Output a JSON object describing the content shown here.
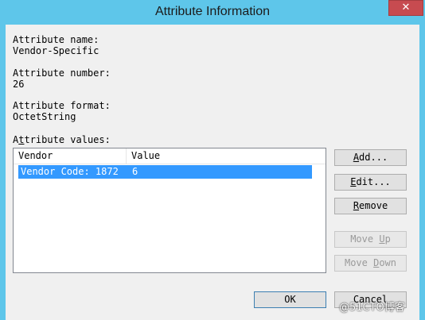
{
  "window": {
    "title": "Attribute Information",
    "close_glyph": "✕"
  },
  "labels": {
    "name_caption": "Attribute name:",
    "name_value": "Vendor-Specific",
    "number_caption": "Attribute number:",
    "number_value": "26",
    "format_caption": "Attribute format:",
    "format_value": "OctetString",
    "values_caption_pre": "A",
    "values_caption_mnemonic": "t",
    "values_caption_post": "tribute values:"
  },
  "table": {
    "columns": [
      "Vendor",
      "Value"
    ],
    "rows": [
      {
        "vendor": "Vendor Code: 1872",
        "value": "6",
        "selected": true
      }
    ]
  },
  "buttons": {
    "add": {
      "mnemonic": "A",
      "rest": "dd..."
    },
    "edit": {
      "mnemonic": "E",
      "rest": "dit..."
    },
    "remove": {
      "mnemonic": "R",
      "rest": "emove"
    },
    "move_up": {
      "pre": "Move ",
      "mnemonic": "U",
      "rest": "p"
    },
    "move_down": {
      "pre": "Move ",
      "mnemonic": "D",
      "rest": "own"
    },
    "ok": "OK",
    "cancel": "Cancel"
  },
  "watermark": "@51CTO博客"
}
